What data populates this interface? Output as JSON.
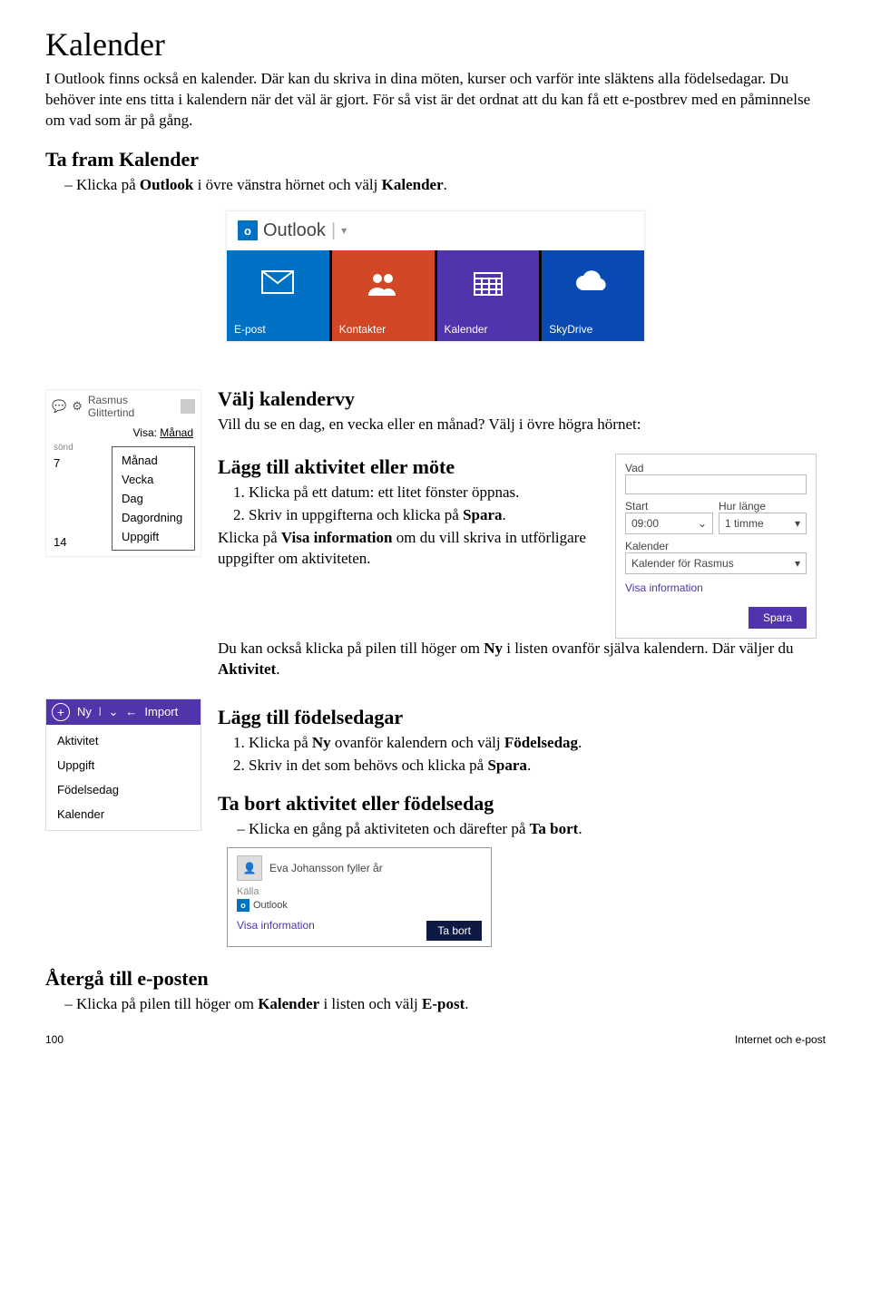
{
  "title": "Kalender",
  "intro": "I Outlook finns också en kalender. Där kan du skriva in dina möten, kurser och varför inte släktens alla födelsedagar. Du behöver inte ens titta i kalendern när det väl är gjort. För så vist är det ordnat att du kan få ett e-postbrev med en påminnelse om vad som är på gång.",
  "sec_takefram": {
    "h": "Ta fram Kalender",
    "li": "Klicka på Outlook i övre vänstra hörnet och välj Kalender."
  },
  "tiles": {
    "brand": "Outlook",
    "items": [
      {
        "label": "E-post"
      },
      {
        "label": "Kontakter"
      },
      {
        "label": "Kalender"
      },
      {
        "label": "SkyDrive"
      }
    ]
  },
  "viewmenu": {
    "user": "Rasmus Glittertind",
    "visa_label": "Visa:",
    "visa_value": "Månad",
    "day_head": "sönd",
    "day_num_top": "7",
    "day_num_bottom": "14",
    "items": [
      "Månad",
      "Vecka",
      "Dag",
      "Dagordning",
      "Uppgift"
    ]
  },
  "sec_view": {
    "h": "Välj kalendervy",
    "p": "Vill du se en dag, en vecka eller en månad? Välj i övre högra hörnet:"
  },
  "sec_add": {
    "h": "Lägg till aktivitet eller möte",
    "li1": "Klicka på ett datum: ett litet fönster öppnas.",
    "li2_pre": "Skriv in uppgifterna och klicka på ",
    "li2_b": "Spara",
    "p1_pre": "Klicka på ",
    "p1_b": "Visa information",
    "p1_post": " om du vill skriva in utförligare uppgifter om aktiviteten.",
    "p2_pre": "Du kan också klicka på pilen till höger om ",
    "p2_b": "Ny",
    "p2_mid": " i listen ovanför själva kalendern. Där väljer du ",
    "p2_b2": "Aktivitet",
    "p2_end": "."
  },
  "savepop": {
    "vad": "Vad",
    "start": "Start",
    "start_val": "09:00",
    "hur": "Hur länge",
    "hur_val": "1 timme",
    "kal_label": "Kalender",
    "kal_val": "Kalender för Rasmus",
    "link": "Visa information",
    "btn": "Spara"
  },
  "sec_bday": {
    "h": "Lägg till födelsedagar",
    "li1_pre": "Klicka på ",
    "li1_b1": "Ny",
    "li1_mid": " ovanför kalendern och välj ",
    "li1_b2": "Födelsedag",
    "li1_end": ".",
    "li2_pre": "Skriv in det som behövs och klicka på ",
    "li2_b": "Spara",
    "li2_end": "."
  },
  "nymenu": {
    "ny": "Ny",
    "import": "Import",
    "items": [
      "Aktivitet",
      "Uppgift",
      "Födelsedag",
      "Kalender"
    ]
  },
  "sec_del": {
    "h": "Ta bort aktivitet eller födelsedag",
    "li_pre": "Klicka en gång på aktiviteten och därefter på ",
    "li_b": "Ta bort",
    "li_end": "."
  },
  "delcard": {
    "title": "Eva Johansson fyller år",
    "source_label": "Källa",
    "source_app": "Outlook",
    "link": "Visa information",
    "btn": "Ta bort"
  },
  "sec_back": {
    "h": "Återgå till e-posten",
    "li_pre": "Klicka på pilen till höger om ",
    "li_b1": "Kalender",
    "li_mid": " i listen och välj ",
    "li_b2": "E-post",
    "li_end": "."
  },
  "footer": {
    "page": "100",
    "right": "Internet och e-post"
  }
}
